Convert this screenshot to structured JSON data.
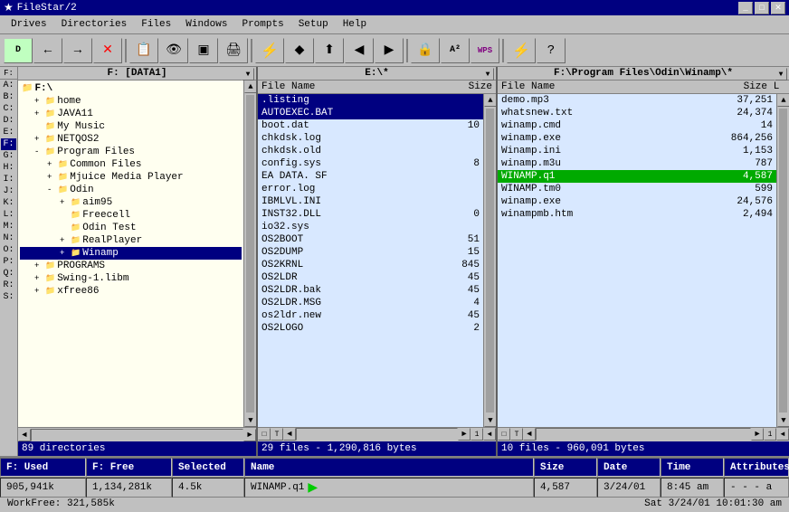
{
  "titlebar": {
    "title": "FileStar/2",
    "icon": "★"
  },
  "menubar": {
    "items": [
      "Drives",
      "Directories",
      "Files",
      "Windows",
      "Prompts",
      "Setup",
      "Help"
    ]
  },
  "toolbar": {
    "buttons": [
      "▶",
      "←",
      "→",
      "✕",
      "📋",
      "📄",
      "▣",
      "🖨",
      "⚡",
      "◆",
      "⏫",
      "◀",
      "▶",
      "🔒",
      "A²",
      "WPS",
      "⚡",
      "?"
    ]
  },
  "left_panel": {
    "title": "F: [DATA1]",
    "tree_root": "F:\\",
    "items": [
      {
        "label": "home",
        "indent": 1,
        "expand": "+",
        "selected": false
      },
      {
        "label": "JAVA11",
        "indent": 1,
        "expand": "+",
        "selected": false
      },
      {
        "label": "My Music",
        "indent": 1,
        "expand": "",
        "selected": false
      },
      {
        "label": "NETQOS2",
        "indent": 1,
        "expand": "+",
        "selected": false
      },
      {
        "label": "Program Files",
        "indent": 1,
        "expand": "-",
        "selected": false
      },
      {
        "label": "Common Files",
        "indent": 2,
        "expand": "+",
        "selected": false
      },
      {
        "label": "Mjuice Media Player",
        "indent": 2,
        "expand": "+",
        "selected": false
      },
      {
        "label": "Odin",
        "indent": 2,
        "expand": "-",
        "selected": false
      },
      {
        "label": "aim95",
        "indent": 3,
        "expand": "+",
        "selected": false
      },
      {
        "label": "Freecell",
        "indent": 3,
        "expand": "",
        "selected": false
      },
      {
        "label": "Odin Test",
        "indent": 3,
        "expand": "",
        "selected": false
      },
      {
        "label": "RealPlayer",
        "indent": 3,
        "expand": "+",
        "selected": false
      },
      {
        "label": "Winamp",
        "indent": 3,
        "expand": "+",
        "selected": true
      },
      {
        "label": "PROGRAMS",
        "indent": 1,
        "expand": "+",
        "selected": false
      },
      {
        "label": "Swing-1.libm",
        "indent": 1,
        "expand": "+",
        "selected": false
      },
      {
        "label": "xfree86",
        "indent": 1,
        "expand": "+",
        "selected": false
      }
    ],
    "status": "89 directories"
  },
  "mid_panel": {
    "title": "E:\\*",
    "col_name": "File Name",
    "col_size": "Size",
    "items": [
      {
        "name": ".listing",
        "size": "",
        "selected": false
      },
      {
        "name": "AUTOEXEC.BAT",
        "size": "",
        "selected": true
      },
      {
        "name": "boot.dat",
        "size": "10",
        "selected": false
      },
      {
        "name": "chkdsk.log",
        "size": "",
        "selected": false
      },
      {
        "name": "chkdsk.old",
        "size": "",
        "selected": false
      },
      {
        "name": "config.sys",
        "size": "8",
        "selected": false
      },
      {
        "name": "EA DATA. SF",
        "size": "",
        "selected": false
      },
      {
        "name": "error.log",
        "size": "",
        "selected": false
      },
      {
        "name": "IBMLVL.INI",
        "size": "",
        "selected": false
      },
      {
        "name": "INST32.DLL",
        "size": "0",
        "selected": false
      },
      {
        "name": "io32.sys",
        "size": "",
        "selected": false
      },
      {
        "name": "OS2BOOT",
        "size": "51",
        "selected": false
      },
      {
        "name": "OS2DUMP",
        "size": "15",
        "selected": false
      },
      {
        "name": "OS2KRNL",
        "size": "845",
        "selected": false
      },
      {
        "name": "OS2LDR",
        "size": "45",
        "selected": false
      },
      {
        "name": "OS2LDR.bak",
        "size": "45",
        "selected": false
      },
      {
        "name": "OS2LDR.MSG",
        "size": "4",
        "selected": false
      },
      {
        "name": "os2ldr.new",
        "size": "45",
        "selected": false
      },
      {
        "name": "OS2LOGO",
        "size": "2",
        "selected": false
      }
    ],
    "status": "29 files - 1,290,816 bytes"
  },
  "right_panel": {
    "title": "F:\\Program Files\\Odin\\Winamp\\*",
    "col_name": "File Name",
    "col_size": "Size",
    "col_l": "L",
    "items": [
      {
        "name": "demo.mp3",
        "size": "37,251",
        "selected": false
      },
      {
        "name": "whatsnew.txt",
        "size": "24,374",
        "selected": false
      },
      {
        "name": "winamp.cmd",
        "size": "14",
        "selected": false
      },
      {
        "name": "winamp.exe",
        "size": "864,256",
        "selected": false
      },
      {
        "name": "Winamp.ini",
        "size": "1,153",
        "selected": false
      },
      {
        "name": "winamp.m3u",
        "size": "787",
        "selected": false
      },
      {
        "name": "WINAMP.q1",
        "size": "4,587",
        "selected": true,
        "highlighted": true
      },
      {
        "name": "WINAMP.tm0",
        "size": "599",
        "selected": false
      },
      {
        "name": "winamp.exe",
        "size": "24,576",
        "selected": false
      },
      {
        "name": "winampmb.htm",
        "size": "2,494",
        "selected": false
      }
    ],
    "status": "10 files - 960,091 bytes"
  },
  "statusbar": {
    "row1": {
      "f_used_label": "F: Used",
      "f_free_label": "F: Free",
      "selected_label": "Selected",
      "name_label": "Name",
      "size_label": "Size",
      "date_label": "Date",
      "time_label": "Time",
      "attributes_label": "Attributes"
    },
    "row2": {
      "f_used_val": "905,941k",
      "f_free_val": "1,134,281k",
      "selected_val": "4.5k",
      "name_val": "WINAMP.q1",
      "size_val": "4,587",
      "date_val": "3/24/01",
      "time_val": "8:45 am",
      "attr_val": "- - - a",
      "workfree": "WorkFree: 321,585k",
      "datetime": "Sat 3/24/01    10:01:30 am"
    }
  }
}
